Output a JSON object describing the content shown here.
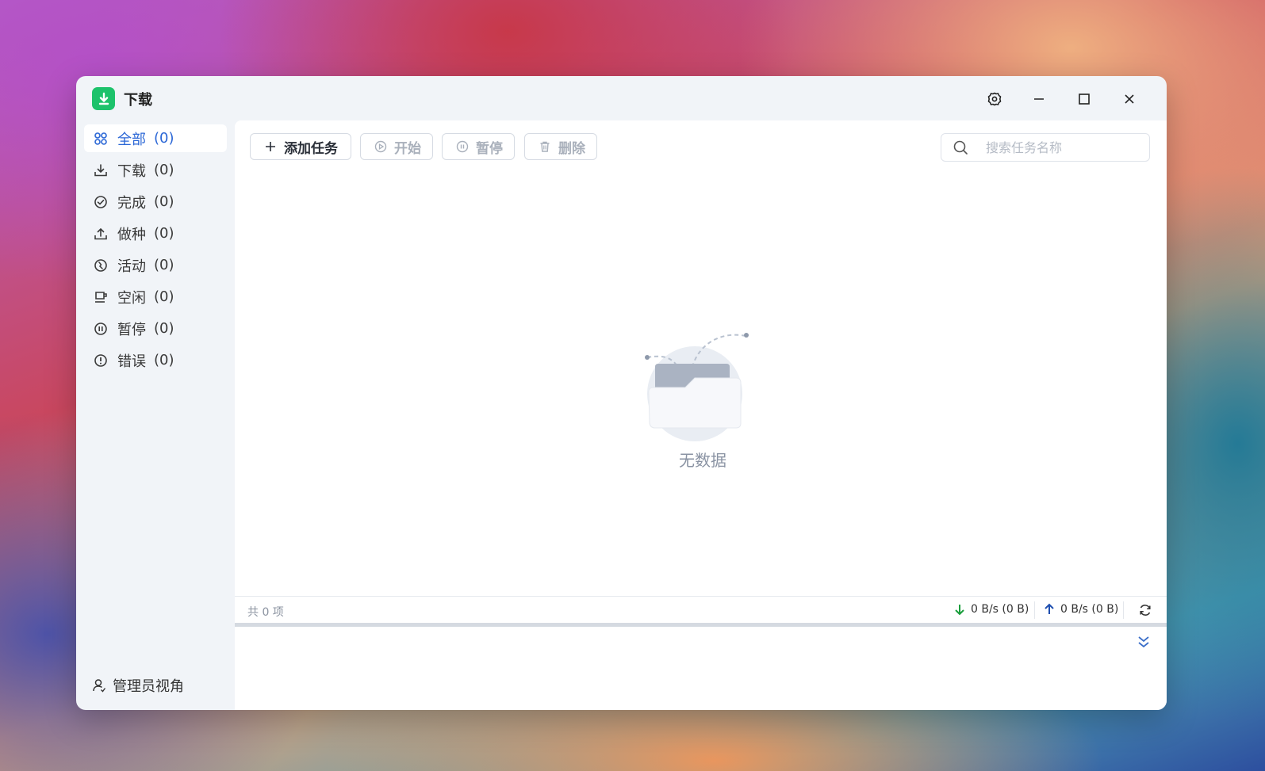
{
  "app": {
    "title": "下载"
  },
  "sidebar": {
    "items": [
      {
        "label": "全部",
        "count": "(0)",
        "icon": "grid-icon",
        "active": true
      },
      {
        "label": "下载",
        "count": "(0)",
        "icon": "download-icon"
      },
      {
        "label": "完成",
        "count": "(0)",
        "icon": "check-circle-icon"
      },
      {
        "label": "做种",
        "count": "(0)",
        "icon": "upload-icon"
      },
      {
        "label": "活动",
        "count": "(0)",
        "icon": "activity-icon"
      },
      {
        "label": "空闲",
        "count": "(0)",
        "icon": "cup-icon"
      },
      {
        "label": "暂停",
        "count": "(0)",
        "icon": "pause-circle-icon"
      },
      {
        "label": "错误",
        "count": "(0)",
        "icon": "error-circle-icon"
      }
    ],
    "admin_label": "管理员视角"
  },
  "toolbar": {
    "add_label": "添加任务",
    "start_label": "开始",
    "pause_label": "暂停",
    "delete_label": "删除"
  },
  "search": {
    "placeholder": "搜索任务名称"
  },
  "empty": {
    "text": "无数据"
  },
  "status": {
    "total": "共 0 项",
    "download_speed": "0 B/s (0 B)",
    "upload_speed": "0 B/s (0 B)"
  },
  "colors": {
    "accent": "#2b67d6",
    "logo": "#1dc26b",
    "download_arrow": "#1a9e3c",
    "upload_arrow": "#1f4fb0"
  }
}
